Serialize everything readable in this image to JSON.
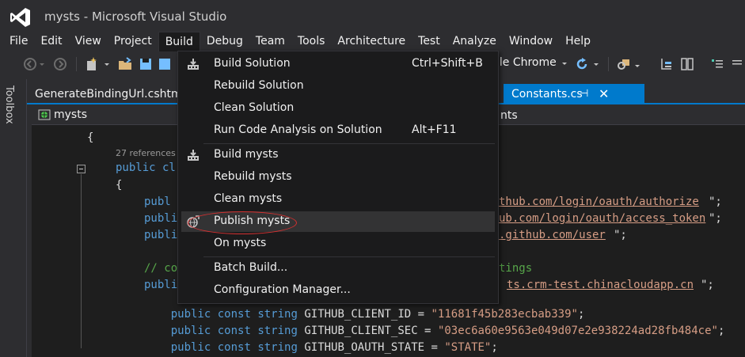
{
  "window": {
    "title": "mysts - Microsoft Visual Studio"
  },
  "menubar": {
    "items": [
      "File",
      "Edit",
      "View",
      "Project",
      "Build",
      "Debug",
      "Team",
      "Tools",
      "Architecture",
      "Test",
      "Analyze",
      "Window",
      "Help"
    ]
  },
  "toolbar": {
    "browser": "gle Chrome"
  },
  "toolbox": {
    "label": "Toolbox"
  },
  "tabs": {
    "left": "GenerateBindingUrl.cshtml",
    "active": "Constants.cs",
    "pin_glyph": "⊣",
    "close_glyph": "✕"
  },
  "navbar": {
    "project": "mysts",
    "right": "nts"
  },
  "build_menu": {
    "items": [
      {
        "label": "Build Solution",
        "shortcut": "Ctrl+Shift+B"
      },
      {
        "label": "Rebuild Solution",
        "shortcut": ""
      },
      {
        "label": "Clean Solution",
        "shortcut": ""
      },
      {
        "label": "Run Code Analysis on Solution",
        "shortcut": "Alt+F11"
      },
      {
        "label": "Build mysts",
        "shortcut": ""
      },
      {
        "label": "Rebuild mysts",
        "shortcut": ""
      },
      {
        "label": "Clean mysts",
        "shortcut": ""
      },
      {
        "label": "Publish mysts",
        "shortcut": ""
      },
      {
        "label": "On mysts",
        "shortcut": ""
      },
      {
        "label": "Batch Build...",
        "shortcut": ""
      },
      {
        "label": "Configuration Manager...",
        "shortcut": ""
      }
    ]
  },
  "code": {
    "brace_open_1": "{",
    "refs": "27 references",
    "class_line": "public cl",
    "brace_open_2": "{",
    "l1_kw": "publ",
    "l1_tail": "thub.com/login/oauth/authorize",
    "l1_end": "\";",
    "l2_kw": "publi",
    "l2_tail": "ub.com/login/oauth/access_token",
    "l2_end": "\";",
    "l3_kw": "publi",
    "l3_tail": ".github.com/user",
    "l3_end": "\";",
    "l4_comment_head": "// co",
    "l4_comment_tail": "tings",
    "l5_kw": "publi",
    "l5_tail": "ts.crm-test.chinacloudapp.cn",
    "l5_end": "\";",
    "l6_public": "public",
    "l6_const": "const",
    "l6_string": "string",
    "l6_name": "GITHUB_CLIENT_ID =",
    "l6_value": "\"11681f45b283ecbab339\"",
    "l6_end": ";",
    "l7_public": "public",
    "l7_const": "const",
    "l7_string": "string",
    "l7_name": "GITHUB_CLIENT_SEC =",
    "l7_value": "\"03ec6a60e9563e049d07e2e938224ad28fb484ce\"",
    "l7_end": ";",
    "l8_public": "public",
    "l8_const": "const",
    "l8_string": "string",
    "l8_name": "GITHUB_OAUTH_STATE =",
    "l8_value": "\"STATE\"",
    "l8_end": ";"
  },
  "colors": {
    "accent": "#007acc",
    "highlight_oval": "#d63030",
    "keyword": "#569cd6",
    "string": "#d69d85",
    "comment": "#57a64a",
    "vs_logo": "#ffffff"
  },
  "icons": {
    "logo": "visual-studio-logo-icon",
    "back": "back-arrow-icon",
    "forward": "forward-arrow-icon",
    "new_project": "new-project-icon",
    "open": "open-folder-icon",
    "save": "save-icon",
    "refresh": "refresh-icon",
    "build": "build-icon",
    "publish": "publish-globe-icon"
  }
}
